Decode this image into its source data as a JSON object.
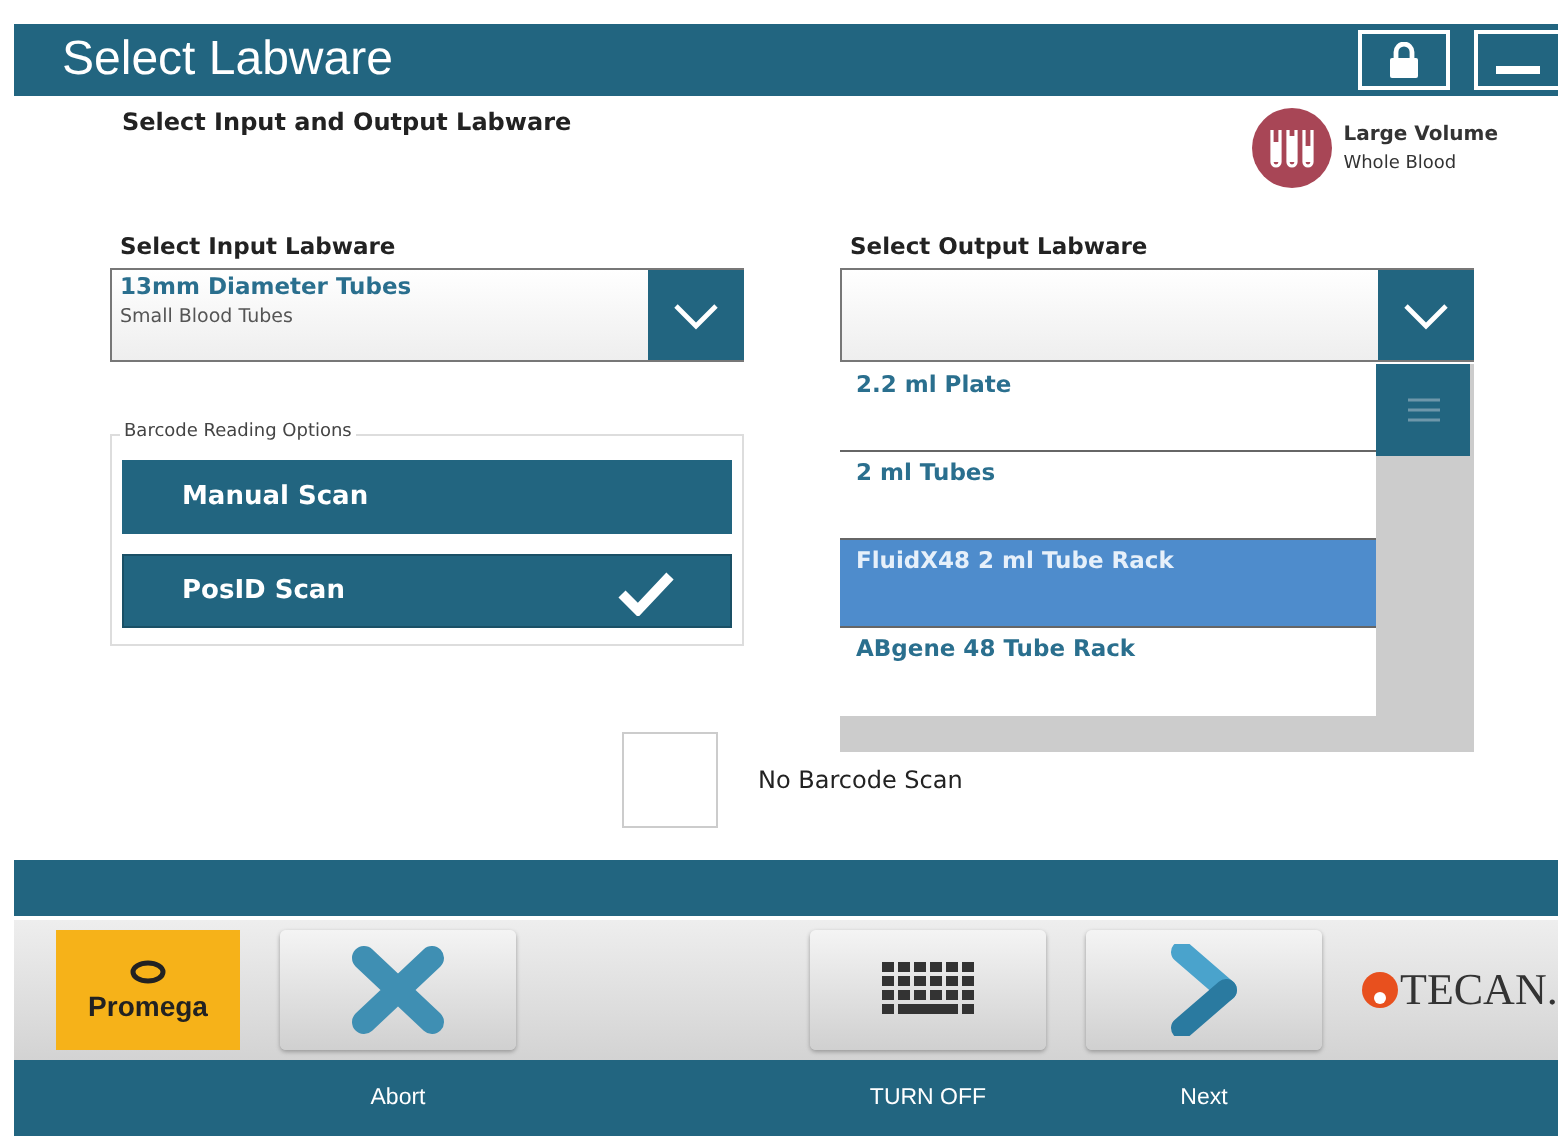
{
  "window": {
    "title": "Select Labware"
  },
  "heading": "Select Input and Output Labware",
  "protocol": {
    "title": "Large Volume",
    "subtitle": "Whole Blood"
  },
  "input": {
    "label": "Select Input Labware",
    "value": "13mm Diameter Tubes",
    "subtext": "Small Blood Tubes"
  },
  "output": {
    "label": "Select Output Labware",
    "expanded": true,
    "items": [
      {
        "label": "2.2  ml Plate",
        "selected": false
      },
      {
        "label": "2 ml Tubes",
        "selected": false
      },
      {
        "label": "FluidX48 2 ml Tube Rack",
        "selected": true
      },
      {
        "label": "ABgene 48 Tube Rack",
        "selected": false
      }
    ]
  },
  "barcode": {
    "legend": "Barcode Reading Options",
    "options": [
      {
        "label": "Manual Scan",
        "selected": false
      },
      {
        "label": "PosID Scan",
        "selected": true
      }
    ]
  },
  "no_barcode": {
    "label": "No Barcode Scan",
    "checked": false
  },
  "toolbar": [
    {
      "kind": "promega",
      "label": "Promega"
    },
    {
      "kind": "abort",
      "label": "Abort"
    },
    {
      "kind": "spacer"
    },
    {
      "kind": "keyboard",
      "label": "TURN OFF"
    },
    {
      "kind": "next",
      "label": "Next"
    },
    {
      "kind": "tecan",
      "label": "TECAN."
    }
  ]
}
